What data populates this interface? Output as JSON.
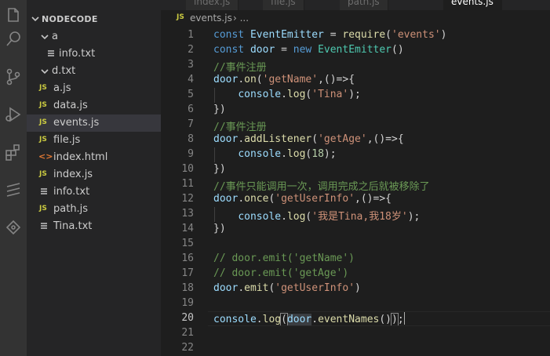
{
  "sidebar": {
    "top_label": "",
    "folder": "NODECODE",
    "items": [
      {
        "label": "a",
        "kind": "folder"
      },
      {
        "label": "info.txt",
        "kind": "txt"
      },
      {
        "label": "d.txt",
        "kind": "folder"
      },
      {
        "label": "a.js",
        "kind": "js",
        "badge": "JS"
      },
      {
        "label": "data.js",
        "kind": "js",
        "badge": "JS"
      },
      {
        "label": "events.js",
        "kind": "js",
        "badge": "JS",
        "selected": true
      },
      {
        "label": "file.js",
        "kind": "js",
        "badge": "JS"
      },
      {
        "label": "index.html",
        "kind": "html",
        "badge": "<>"
      },
      {
        "label": "index.js",
        "kind": "js",
        "badge": "JS"
      },
      {
        "label": "info.txt",
        "kind": "txt"
      },
      {
        "label": "path.js",
        "kind": "js",
        "badge": "JS"
      },
      {
        "label": "Tina.txt",
        "kind": "txt"
      }
    ]
  },
  "tabs": [
    {
      "label": "index.js"
    },
    {
      "label": "file.js"
    },
    {
      "label": "path.js"
    },
    {
      "label": "events.js",
      "active": true
    }
  ],
  "breadcrumb": {
    "badge": "JS",
    "file": "events.js",
    "separator": "› ..."
  },
  "editor": {
    "current_line": 20,
    "line_numbers": [
      "1",
      "2",
      "3",
      "4",
      "5",
      "6",
      "7",
      "8",
      "9",
      "10",
      "11",
      "12",
      "13",
      "14",
      "15",
      "16",
      "17",
      "18",
      "19",
      "20",
      "21",
      "22"
    ],
    "lines": [
      [
        [
          "kw",
          "const "
        ],
        [
          "var",
          "EventEmitter"
        ],
        [
          "pun",
          " = "
        ],
        [
          "fn",
          "require"
        ],
        [
          "pun",
          "("
        ],
        [
          "str",
          "'events'"
        ],
        [
          "pun",
          ")"
        ]
      ],
      [
        [
          "kw",
          "const "
        ],
        [
          "var",
          "door"
        ],
        [
          "pun",
          " = "
        ],
        [
          "kw",
          "new "
        ],
        [
          "cls",
          "EventEmitter"
        ],
        [
          "pun",
          "()"
        ]
      ],
      [
        [
          "com",
          "//事件注册"
        ]
      ],
      [
        [
          "var",
          "door"
        ],
        [
          "pun",
          "."
        ],
        [
          "fn",
          "on"
        ],
        [
          "pun",
          "("
        ],
        [
          "str",
          "'getName'"
        ],
        [
          "pun",
          ",()=>{"
        ]
      ],
      [
        [
          "pun",
          "    "
        ],
        [
          "var",
          "console"
        ],
        [
          "pun",
          "."
        ],
        [
          "fn",
          "log"
        ],
        [
          "pun",
          "("
        ],
        [
          "str",
          "'Tina'"
        ],
        [
          "pun",
          ");"
        ]
      ],
      [
        [
          "pun",
          "})"
        ]
      ],
      [
        [
          "com",
          "//事件注册"
        ]
      ],
      [
        [
          "var",
          "door"
        ],
        [
          "pun",
          "."
        ],
        [
          "fn",
          "addListener"
        ],
        [
          "pun",
          "("
        ],
        [
          "str",
          "'getAge'"
        ],
        [
          "pun",
          ",()=>{"
        ]
      ],
      [
        [
          "pun",
          "    "
        ],
        [
          "var",
          "console"
        ],
        [
          "pun",
          "."
        ],
        [
          "fn",
          "log"
        ],
        [
          "pun",
          "("
        ],
        [
          "num",
          "18"
        ],
        [
          "pun",
          ");"
        ]
      ],
      [
        [
          "pun",
          "})"
        ]
      ],
      [
        [
          "com",
          "//事件只能调用一次，调用完成之后就被移除了"
        ]
      ],
      [
        [
          "var",
          "door"
        ],
        [
          "pun",
          "."
        ],
        [
          "fn",
          "once"
        ],
        [
          "pun",
          "("
        ],
        [
          "str",
          "'getUserInfo'"
        ],
        [
          "pun",
          ",()=>{"
        ]
      ],
      [
        [
          "pun",
          "    "
        ],
        [
          "var",
          "console"
        ],
        [
          "pun",
          "."
        ],
        [
          "fn",
          "log"
        ],
        [
          "pun",
          "("
        ],
        [
          "str",
          "'我是Tina,我18岁'"
        ],
        [
          "pun",
          ");"
        ]
      ],
      [
        [
          "pun",
          "})"
        ]
      ],
      [],
      [
        [
          "com",
          "// door.emit('getName')"
        ]
      ],
      [
        [
          "com",
          "// door.emit('getAge')"
        ]
      ],
      [
        [
          "var",
          "door"
        ],
        [
          "pun",
          "."
        ],
        [
          "fn",
          "emit"
        ],
        [
          "pun",
          "("
        ],
        [
          "str",
          "'getUserInfo'"
        ],
        [
          "pun",
          ")"
        ]
      ],
      [],
      [
        [
          "var",
          "console"
        ],
        [
          "pun",
          "."
        ],
        [
          "fn",
          "log"
        ],
        [
          "pun bm",
          "("
        ],
        [
          "var hl",
          "door"
        ],
        [
          "pun",
          "."
        ],
        [
          "fn",
          "eventNames"
        ],
        [
          "pun",
          "()"
        ],
        [
          "pun bm",
          ")"
        ],
        [
          "pun",
          ";"
        ],
        [
          "caret",
          ""
        ]
      ],
      [],
      []
    ]
  },
  "colors": {
    "keyword": "#569cd6",
    "variable": "#9cdcfe",
    "class": "#4ec9b0",
    "function": "#dcdcaa",
    "string": "#ce9178",
    "number": "#b5cea8",
    "comment": "#6a9955"
  }
}
